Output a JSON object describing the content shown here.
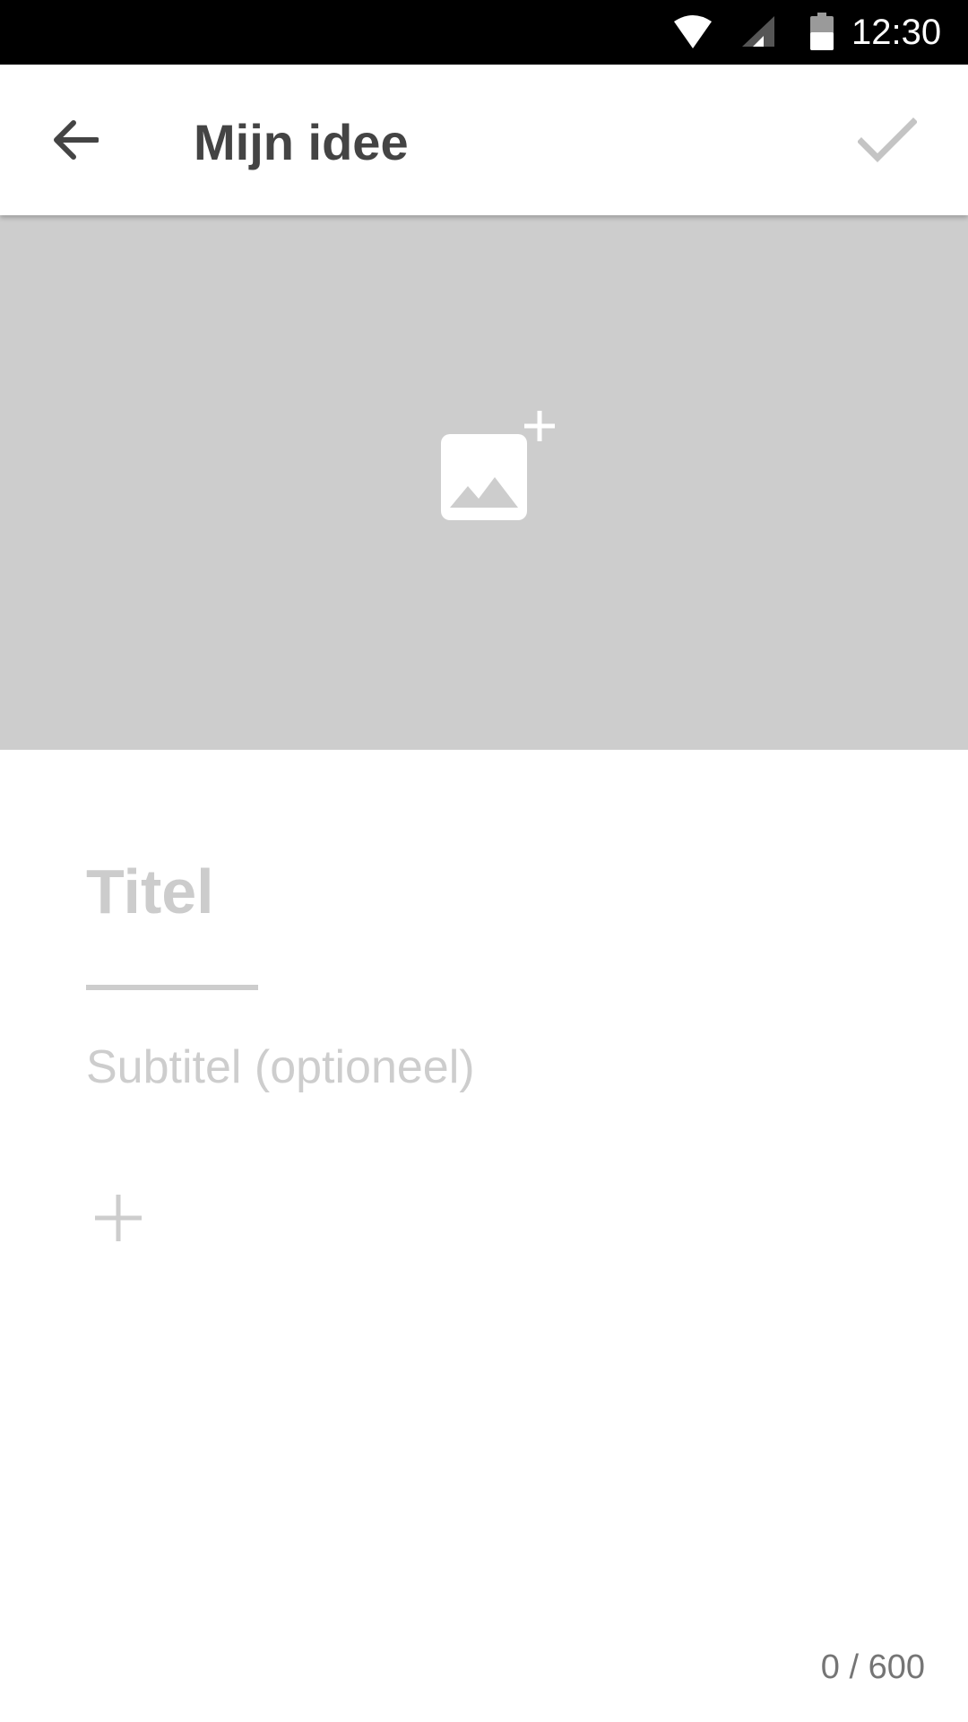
{
  "status_bar": {
    "time": "12:30",
    "icons": [
      "wifi-icon",
      "cell-signal-icon",
      "battery-icon"
    ]
  },
  "app_bar": {
    "title": "Mijn idee",
    "back_icon": "arrow-back-icon",
    "done_icon": "check-icon"
  },
  "header_image": {
    "icon": "add-photo-icon",
    "background_color": "#cdcdcd"
  },
  "form": {
    "title_placeholder": "Titel",
    "subtitle_placeholder": "Subtitel (optioneel)",
    "add_icon": "plus-icon",
    "char_counter": "0 / 600"
  },
  "colors": {
    "status_bar": "#000000",
    "app_bar": "#ffffff",
    "title_text": "#444444",
    "placeholder": "#cccccc",
    "counter_text": "#757575"
  }
}
